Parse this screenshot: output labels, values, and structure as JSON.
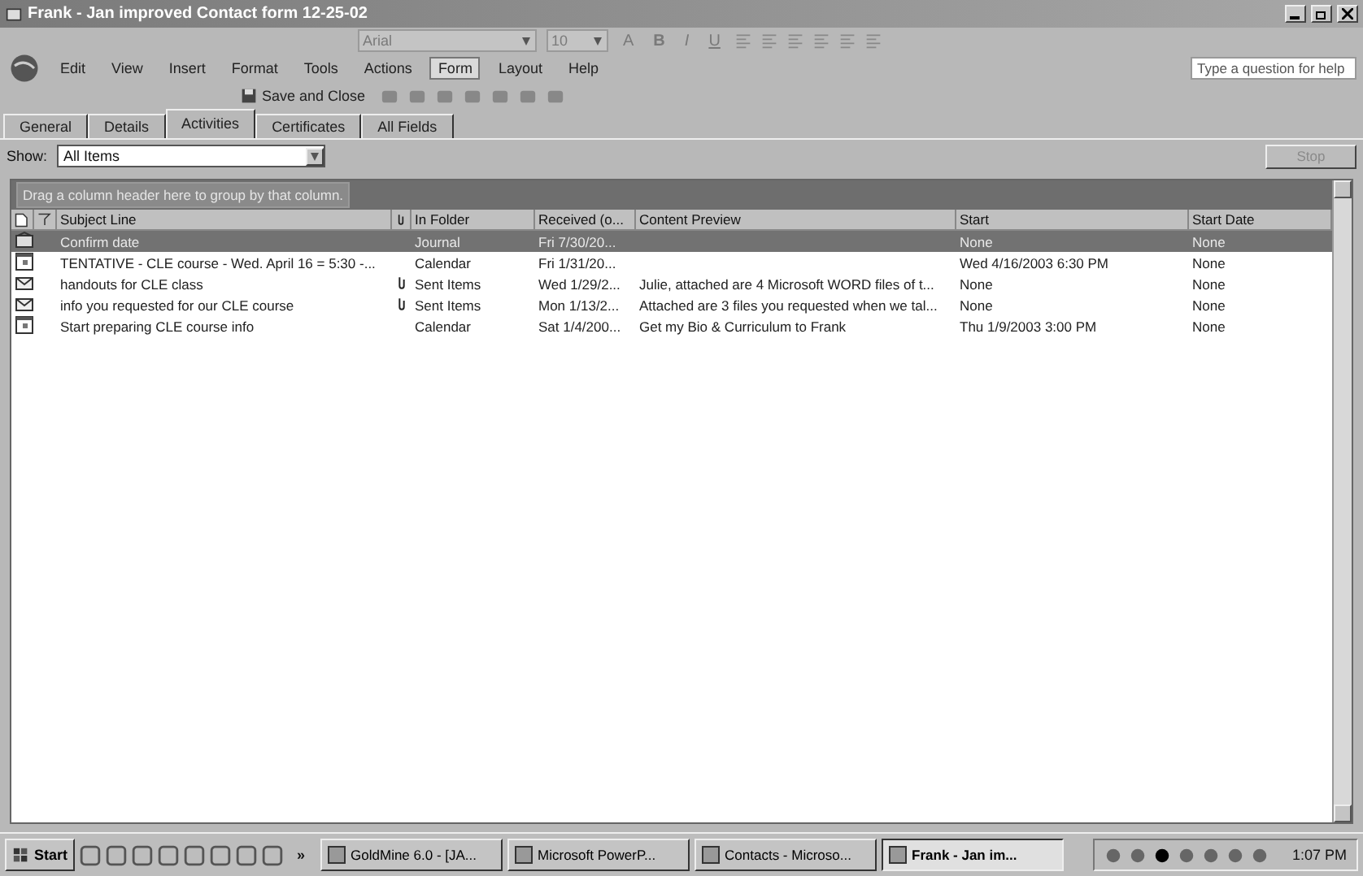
{
  "window": {
    "title": "Frank - Jan improved Contact form 12-25-02"
  },
  "formatting_toolbar": {
    "font": "Arial",
    "size": "10",
    "buttons": [
      "A",
      "B",
      "I",
      "U"
    ]
  },
  "menu": [
    {
      "label": "Edit",
      "selected": false
    },
    {
      "label": "View",
      "selected": false
    },
    {
      "label": "Insert",
      "selected": false
    },
    {
      "label": "Format",
      "selected": false
    },
    {
      "label": "Tools",
      "selected": false
    },
    {
      "label": "Actions",
      "selected": false
    },
    {
      "label": "Form",
      "selected": true
    },
    {
      "label": "Layout",
      "selected": false
    },
    {
      "label": "Help",
      "selected": false
    }
  ],
  "help": {
    "placeholder": "Type a question for help"
  },
  "standard_toolbar": {
    "save_button": "Save and Close"
  },
  "tabs": [
    {
      "label": "General",
      "selected": false
    },
    {
      "label": "Details",
      "selected": false
    },
    {
      "label": "Activities",
      "selected": true
    },
    {
      "label": "Certificates",
      "selected": false
    },
    {
      "label": "All Fields",
      "selected": false
    }
  ],
  "show": {
    "label": "Show:",
    "value": "All Items",
    "stop_button": "Stop"
  },
  "group_hint": "Drag a column header here to group by that column.",
  "table": {
    "columns": [
      "Subject Line",
      "In Folder",
      "Received (o...",
      "Content Preview",
      "Start",
      "Start Date"
    ],
    "rows": [
      {
        "kind": "journal",
        "attachment": false,
        "selected": true,
        "cells": [
          "Confirm date",
          "Journal",
          "Fri 7/30/20...",
          "",
          "None",
          "None"
        ]
      },
      {
        "kind": "calendar",
        "attachment": false,
        "selected": false,
        "cells": [
          "TENTATIVE - CLE course - Wed. April 16 = 5:30 -...",
          "Calendar",
          "Fri 1/31/20...",
          "",
          "Wed 4/16/2003 6:30 PM",
          "None"
        ]
      },
      {
        "kind": "mail",
        "attachment": true,
        "selected": false,
        "cells": [
          "handouts for CLE class",
          "Sent Items",
          "Wed 1/29/2...",
          "Julie, attached are 4 Microsoft WORD files of t...",
          "None",
          "None"
        ]
      },
      {
        "kind": "mail",
        "attachment": true,
        "selected": false,
        "cells": [
          "info you requested for our CLE course",
          "Sent Items",
          "Mon 1/13/2...",
          "Attached are 3 files you requested when we tal...",
          "None",
          "None"
        ]
      },
      {
        "kind": "calendar",
        "attachment": false,
        "selected": false,
        "cells": [
          "Start preparing CLE course info",
          "Calendar",
          "Sat 1/4/200...",
          "Get my  Bio & Curriculum to Frank",
          "Thu 1/9/2003 3:00 PM",
          "None"
        ]
      }
    ]
  },
  "taskbar": {
    "start": "Start",
    "more": "»",
    "tasks": [
      {
        "label": "GoldMine 6.0 - [JA...",
        "selected": false
      },
      {
        "label": "Microsoft PowerP...",
        "selected": false
      },
      {
        "label": "Contacts - Microso...",
        "selected": false
      },
      {
        "label": "Frank - Jan im...",
        "selected": true
      }
    ],
    "clock": "1:07 PM"
  }
}
